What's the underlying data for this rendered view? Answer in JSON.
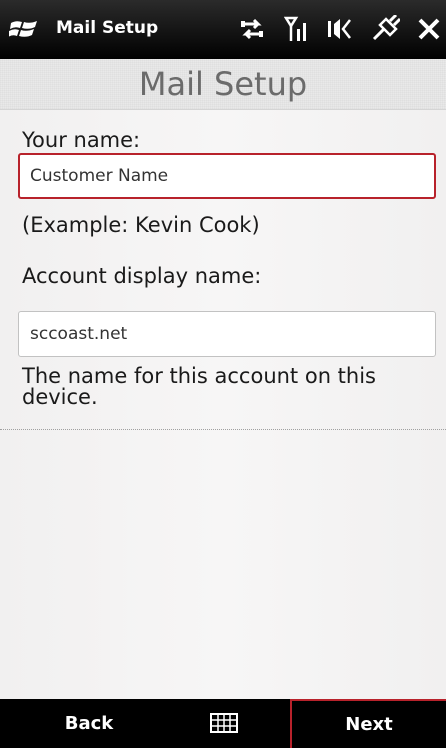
{
  "titlebar": {
    "app_title": "Mail Setup",
    "icons": [
      "windows-logo-icon",
      "connectivity-icon",
      "signal-icon",
      "volume-icon",
      "battery-charging-icon",
      "close-icon"
    ]
  },
  "page": {
    "heading": "Mail Setup"
  },
  "form": {
    "your_name_label": "Your name:",
    "your_name_value": "Customer Name",
    "your_name_example": "(Example: Kevin Cook)",
    "account_display_name_label": "Account display name:",
    "account_display_name_value": "sccoast.net",
    "account_display_name_hint": "The name for this account on this device."
  },
  "softkeys": {
    "left": "Back",
    "center_icon": "keyboard-icon",
    "right": "Next"
  },
  "colors": {
    "accent": "#b8222b",
    "titlebar": "#000000",
    "heading_text": "#6b6b6b",
    "background": "#f4f3f3"
  }
}
